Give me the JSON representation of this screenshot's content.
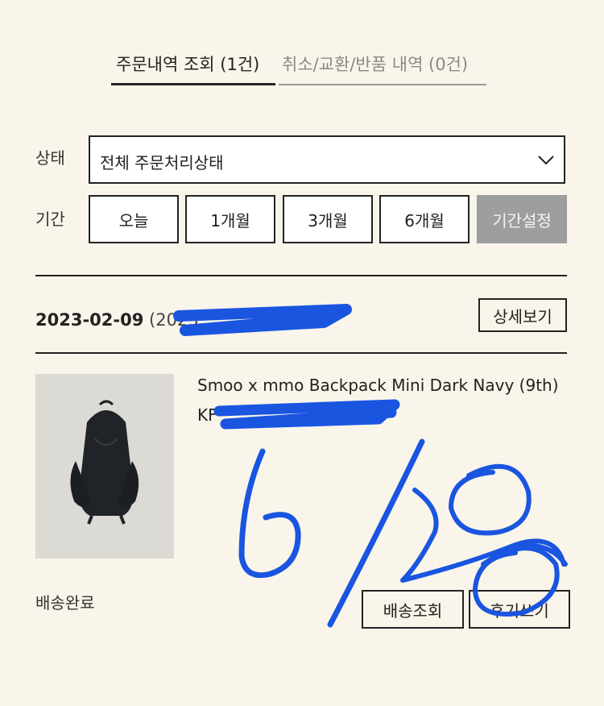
{
  "tabs": {
    "orders": "주문내역 조회  (1건)",
    "cancel_exchange_return": "취소/교환/반품 내역  (0건)"
  },
  "filter": {
    "status_label": "상태",
    "status_value": "전체 주문처리상태",
    "period_label": "기간",
    "periods": [
      "오늘",
      "1개월",
      "3개월",
      "6개월"
    ],
    "custom_period": "기간설정"
  },
  "order": {
    "date": "2023-02-09",
    "order_number_visible": "(2023",
    "detail_button": "상세보기",
    "product_name": "Smoo x mmo Backpack Mini Dark Navy (9th)",
    "product_option_visible": "KF",
    "status": "배송완료",
    "track_button": "배송조회",
    "review_button": "후기쓰기"
  },
  "colors": {
    "background": "#f9f5ea",
    "scribble": "#1a55e0",
    "custom_button": "#9e9e9e"
  }
}
